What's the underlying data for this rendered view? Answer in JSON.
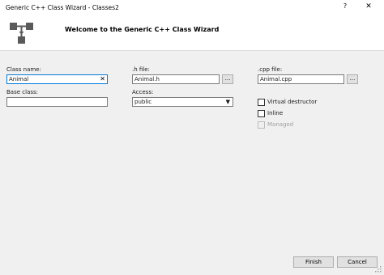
{
  "window": {
    "title": "Generic C++ Class Wizard - Classes2",
    "help_label": "?",
    "close_label": "✕"
  },
  "header": {
    "welcome": "Welcome to the Generic C++ Class Wizard"
  },
  "form": {
    "class_name": {
      "label": "Class name:",
      "value": "Animal",
      "clear_label": "✕"
    },
    "h_file": {
      "label": ".h file:",
      "value": "Animal.h",
      "browse_label": "..."
    },
    "cpp_file": {
      "label": ".cpp file:",
      "value": "Animal.cpp",
      "browse_label": "..."
    },
    "base_class": {
      "label": "Base class:",
      "value": ""
    },
    "access": {
      "label": "Access:",
      "selected": "public"
    },
    "options": {
      "virtual_destructor": {
        "label": "Virtual destructor",
        "checked": false,
        "enabled": true
      },
      "inline": {
        "label": "Inline",
        "checked": false,
        "enabled": true
      },
      "managed": {
        "label": "Managed",
        "checked": false,
        "enabled": false
      }
    }
  },
  "footer": {
    "finish_label": "Finish",
    "cancel_label": "Cancel"
  },
  "icons": {
    "wizard": "class-diagram-icon",
    "close": "close-icon",
    "help": "help-icon",
    "dropdown": "chevron-down-icon",
    "grip": "resize-grip-icon"
  }
}
